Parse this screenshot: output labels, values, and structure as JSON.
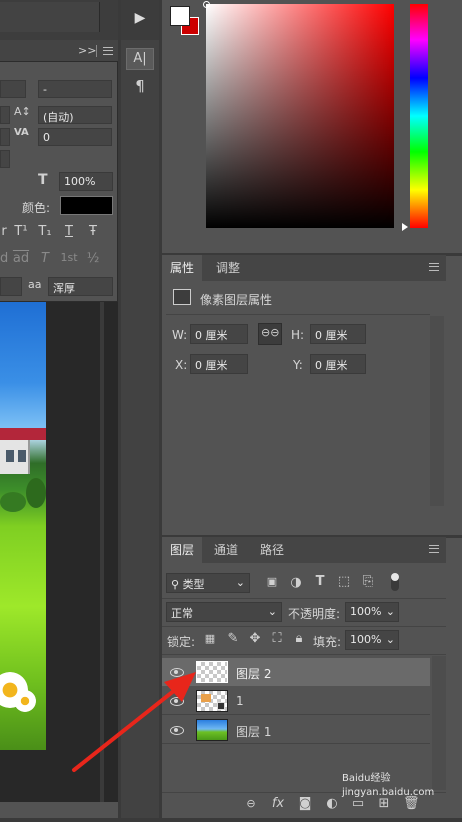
{
  "character_panel": {
    "dash_value": "-",
    "leading_value": "(自动)",
    "tracking_value": "0",
    "vertical_scale": "100%",
    "color_label": "颜色:",
    "style_glyphs": [
      "r",
      "T¹",
      "T₁",
      "T",
      "Ŧ"
    ],
    "opentype_glyphs": [
      "d",
      "ad",
      "T",
      "1st",
      "½"
    ],
    "aa_label": "aa",
    "antialias_value": "浑厚"
  },
  "side_toolbar": {
    "play_icon": "▶",
    "character_icon": "A|",
    "paragraph_icon": "¶"
  },
  "color_picker": {
    "foreground": "#ffffff",
    "background": "#cc0000",
    "hue": "#ff0000"
  },
  "properties_panel": {
    "tabs": [
      "属性",
      "调整"
    ],
    "title": "像素图层属性",
    "w_label": "W:",
    "w_value": "0 厘米",
    "h_label": "H:",
    "h_value": "0 厘米",
    "x_label": "X:",
    "x_value": "0 厘米",
    "y_label": "Y:",
    "y_value": "0 厘米"
  },
  "layers_panel": {
    "tabs": [
      "图层",
      "通道",
      "路径"
    ],
    "filter_value": "类型",
    "blend_mode": "正常",
    "opacity_label": "不透明度:",
    "opacity_value": "100%",
    "lock_label": "锁定:",
    "fill_label": "填充:",
    "fill_value": "100%",
    "layers": [
      {
        "name": "图层 2",
        "selected": true
      },
      {
        "name": "1",
        "selected": false
      },
      {
        "name": "图层 1",
        "selected": false
      }
    ],
    "footer_icons": [
      "link-icon",
      "fx-icon",
      "mask-icon",
      "adjustment-icon",
      "group-icon",
      "new-layer-icon",
      "trash-icon"
    ],
    "fx_label": "fx"
  },
  "watermark": "Baidu经验 jingyan.baidu.com",
  "annotation_color": "#e8261b"
}
